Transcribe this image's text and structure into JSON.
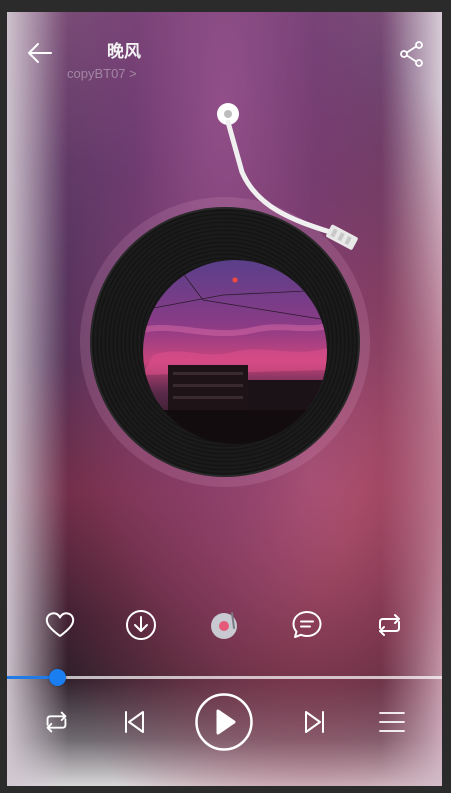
{
  "header": {
    "title": "晚风",
    "artist": "copyBT07 >"
  },
  "icons": {
    "back": "arrow-left-icon",
    "share": "share-icon",
    "like": "heart-icon",
    "download": "download-icon",
    "sound_effect": "vinyl-effect-icon",
    "comment": "comment-icon",
    "repeat": "repeat-icon",
    "prev": "previous-icon",
    "play": "play-icon",
    "next": "next-icon",
    "playlist": "playlist-icon"
  },
  "progress": {
    "fraction": 0.115
  },
  "colors": {
    "accent": "#1a7df0",
    "icon": "#ffffff"
  }
}
